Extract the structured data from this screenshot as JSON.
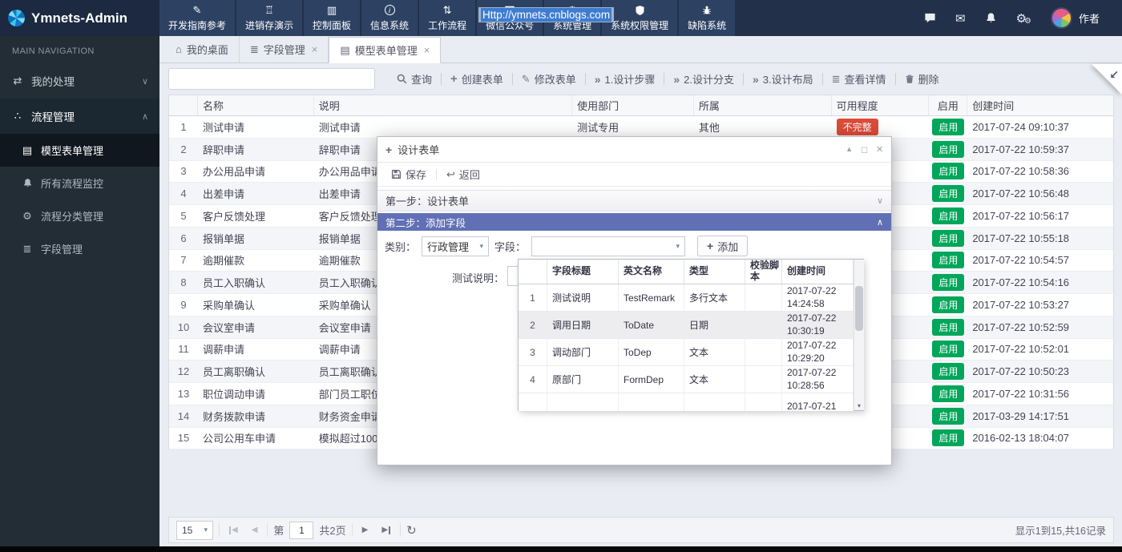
{
  "colors": {
    "navbar": "#22304a",
    "sidebar": "#222d35",
    "enabled_badge": "#00a65a",
    "incomplete_badge": "#dd4b39",
    "step2_header": "#6170b5"
  },
  "icons": {
    "close": "×",
    "caret_down": "▾",
    "chevron_down": "∨",
    "chevron_up": "∧",
    "double_arrow": "»",
    "home": "⌂",
    "list": "≣",
    "form": "▤",
    "gear": "⚙",
    "mail": "✉",
    "exchange": "⇄",
    "share": "∴",
    "pencil": "✎",
    "plus": "+",
    "back": "↩",
    "refresh": "↻",
    "prev": "◀",
    "next": "▶",
    "minimize": "▲",
    "maximize": "□",
    "bank": "♖",
    "dashboard": "▥",
    "info_i": "i",
    "sort": "⇅",
    "corner_arrow": "↙"
  },
  "navbar": {
    "brand": "Ymnets-Admin",
    "url_selection": "Http://ymnets.cnblogs.com",
    "user_name": "作者",
    "items": [
      {
        "label": "开发指南参考",
        "icon": "pencil-icon"
      },
      {
        "label": "进销存演示",
        "icon": "bank-icon"
      },
      {
        "label": "控制面板",
        "icon": "dashboard-icon"
      },
      {
        "label": "信息系统",
        "icon": "info-icon"
      },
      {
        "label": "工作流程",
        "icon": "workflow-sort-icon"
      },
      {
        "label": "微信公众号",
        "icon": "wechat-icon"
      },
      {
        "label": "系统管理",
        "icon": "gear-icon"
      },
      {
        "label": "系统权限管理",
        "icon": "shield-icon"
      },
      {
        "label": "缺陷系统",
        "icon": "bug-icon"
      }
    ]
  },
  "sidebar": {
    "section_label": "MAIN NAVIGATION",
    "my_tasks": {
      "label": "我的处理"
    },
    "process_mgmt": {
      "label": "流程管理"
    },
    "subitems": [
      {
        "label": "模型表单管理",
        "active": true
      },
      {
        "label": "所有流程监控"
      },
      {
        "label": "流程分类管理"
      },
      {
        "label": "字段管理"
      }
    ]
  },
  "tabs": [
    {
      "label": "我的桌面",
      "closable": false
    },
    {
      "label": "字段管理",
      "closable": true
    },
    {
      "label": "模型表单管理",
      "closable": true,
      "active": true
    }
  ],
  "toolbar": {
    "search_value": "",
    "buttons": [
      {
        "label": "查询",
        "icon": "search-icon"
      },
      {
        "label": "创建表单",
        "icon": "plus-icon"
      },
      {
        "label": "修改表单",
        "icon": "pencil-icon"
      },
      {
        "label": "1.设计步骤",
        "icon": "double-arrow-icon"
      },
      {
        "label": "2.设计分支",
        "icon": "double-arrow-icon"
      },
      {
        "label": "3.设计布局",
        "icon": "double-arrow-icon"
      },
      {
        "label": "查看详情",
        "icon": "list-icon"
      },
      {
        "label": "删除",
        "icon": "trash-icon"
      }
    ]
  },
  "grid": {
    "headers": [
      "名称",
      "说明",
      "使用部门",
      "所属",
      "可用程度",
      "启用",
      "创建时间"
    ],
    "rows": [
      {
        "idx": 1,
        "name": "测试申请",
        "desc": "测试申请",
        "dept": "测试专用",
        "owner": "其他",
        "avail": "不完整",
        "enabled": "启用",
        "created": "2017-07-24 09:10:37"
      },
      {
        "idx": 2,
        "name": "辞职申请",
        "desc": "辞职申请",
        "dept": "",
        "owner": "",
        "avail": "",
        "enabled": "启用",
        "created": "2017-07-22 10:59:37"
      },
      {
        "idx": 3,
        "name": "办公用品申请",
        "desc": "办公用品申请",
        "dept": "",
        "owner": "",
        "avail": "",
        "enabled": "启用",
        "created": "2017-07-22 10:58:36"
      },
      {
        "idx": 4,
        "name": "出差申请",
        "desc": "出差申请",
        "dept": "",
        "owner": "",
        "avail": "",
        "enabled": "启用",
        "created": "2017-07-22 10:56:48"
      },
      {
        "idx": 5,
        "name": "客户反馈处理",
        "desc": "客户反馈处理",
        "dept": "",
        "owner": "",
        "avail": "",
        "enabled": "启用",
        "created": "2017-07-22 10:56:17"
      },
      {
        "idx": 6,
        "name": "报销单据",
        "desc": "报销单据",
        "dept": "",
        "owner": "",
        "avail": "",
        "enabled": "启用",
        "created": "2017-07-22 10:55:18"
      },
      {
        "idx": 7,
        "name": "逾期催款",
        "desc": "逾期催款",
        "dept": "",
        "owner": "",
        "avail": "",
        "enabled": "启用",
        "created": "2017-07-22 10:54:57"
      },
      {
        "idx": 8,
        "name": "员工入职确认",
        "desc": "员工入职确认",
        "dept": "",
        "owner": "",
        "avail": "",
        "enabled": "启用",
        "created": "2017-07-22 10:54:16"
      },
      {
        "idx": 9,
        "name": "采购单确认",
        "desc": "采购单确认",
        "dept": "",
        "owner": "",
        "avail": "",
        "enabled": "启用",
        "created": "2017-07-22 10:53:27"
      },
      {
        "idx": 10,
        "name": "会议室申请",
        "desc": "会议室申请",
        "dept": "",
        "owner": "",
        "avail": "",
        "enabled": "启用",
        "created": "2017-07-22 10:52:59"
      },
      {
        "idx": 11,
        "name": "调薪申请",
        "desc": "调薪申请",
        "dept": "",
        "owner": "",
        "avail": "",
        "enabled": "启用",
        "created": "2017-07-22 10:52:01"
      },
      {
        "idx": 12,
        "name": "员工离职确认",
        "desc": "员工离职确认",
        "dept": "",
        "owner": "",
        "avail": "",
        "enabled": "启用",
        "created": "2017-07-22 10:50:23"
      },
      {
        "idx": 13,
        "name": "职位调动申请",
        "desc": "部门员工职位",
        "dept": "",
        "owner": "",
        "avail": "",
        "enabled": "启用",
        "created": "2017-07-22 10:31:56"
      },
      {
        "idx": 14,
        "name": "财务拨款申请",
        "desc": "财务资金申请",
        "dept": "",
        "owner": "",
        "avail": "",
        "enabled": "启用",
        "created": "2017-03-29 14:17:51"
      },
      {
        "idx": 15,
        "name": "公司公用车申请",
        "desc": "模拟超过100",
        "dept": "",
        "owner": "",
        "avail": "",
        "enabled": "启用",
        "created": "2016-02-13 18:04:07"
      }
    ]
  },
  "pager": {
    "page_size": "15",
    "page_word": "第",
    "page_value": "1",
    "total_pages": "共2页",
    "summary": "显示1到15,共16记录"
  },
  "modal": {
    "title": "设计表单",
    "save_label": "保存",
    "back_label": "返回",
    "step1_label": "第一步：设计表单",
    "step2_label": "第二步：添加字段",
    "category_label": "类别：",
    "category_value": "行政管理",
    "field_label": "字段：",
    "field_value": "",
    "add_label": "添加",
    "remark_label": "测试说明：",
    "field_table": {
      "headers": [
        "字段标题",
        "英文名称",
        "类型",
        "校验脚本",
        "创建时间"
      ],
      "rows": [
        {
          "idx": 1,
          "title": "测试说明",
          "en": "TestRemark",
          "type": "多行文本",
          "script": "",
          "created_date": "2017-07-22",
          "created_time": "14:24:58"
        },
        {
          "idx": 2,
          "title": "调用日期",
          "en": "ToDate",
          "type": "日期",
          "script": "",
          "created_date": "2017-07-22",
          "created_time": "10:30:19",
          "highlight": true
        },
        {
          "idx": 3,
          "title": "调动部门",
          "en": "ToDep",
          "type": "文本",
          "script": "",
          "created_date": "2017-07-22",
          "created_time": "10:29:20"
        },
        {
          "idx": 4,
          "title": "原部门",
          "en": "FormDep",
          "type": "文本",
          "script": "",
          "created_date": "2017-07-22",
          "created_time": "10:28:56"
        },
        {
          "idx": "",
          "title": "",
          "en": "",
          "type": "",
          "script": "",
          "created_date": "2017-07-21",
          "created_time": ""
        }
      ]
    }
  }
}
